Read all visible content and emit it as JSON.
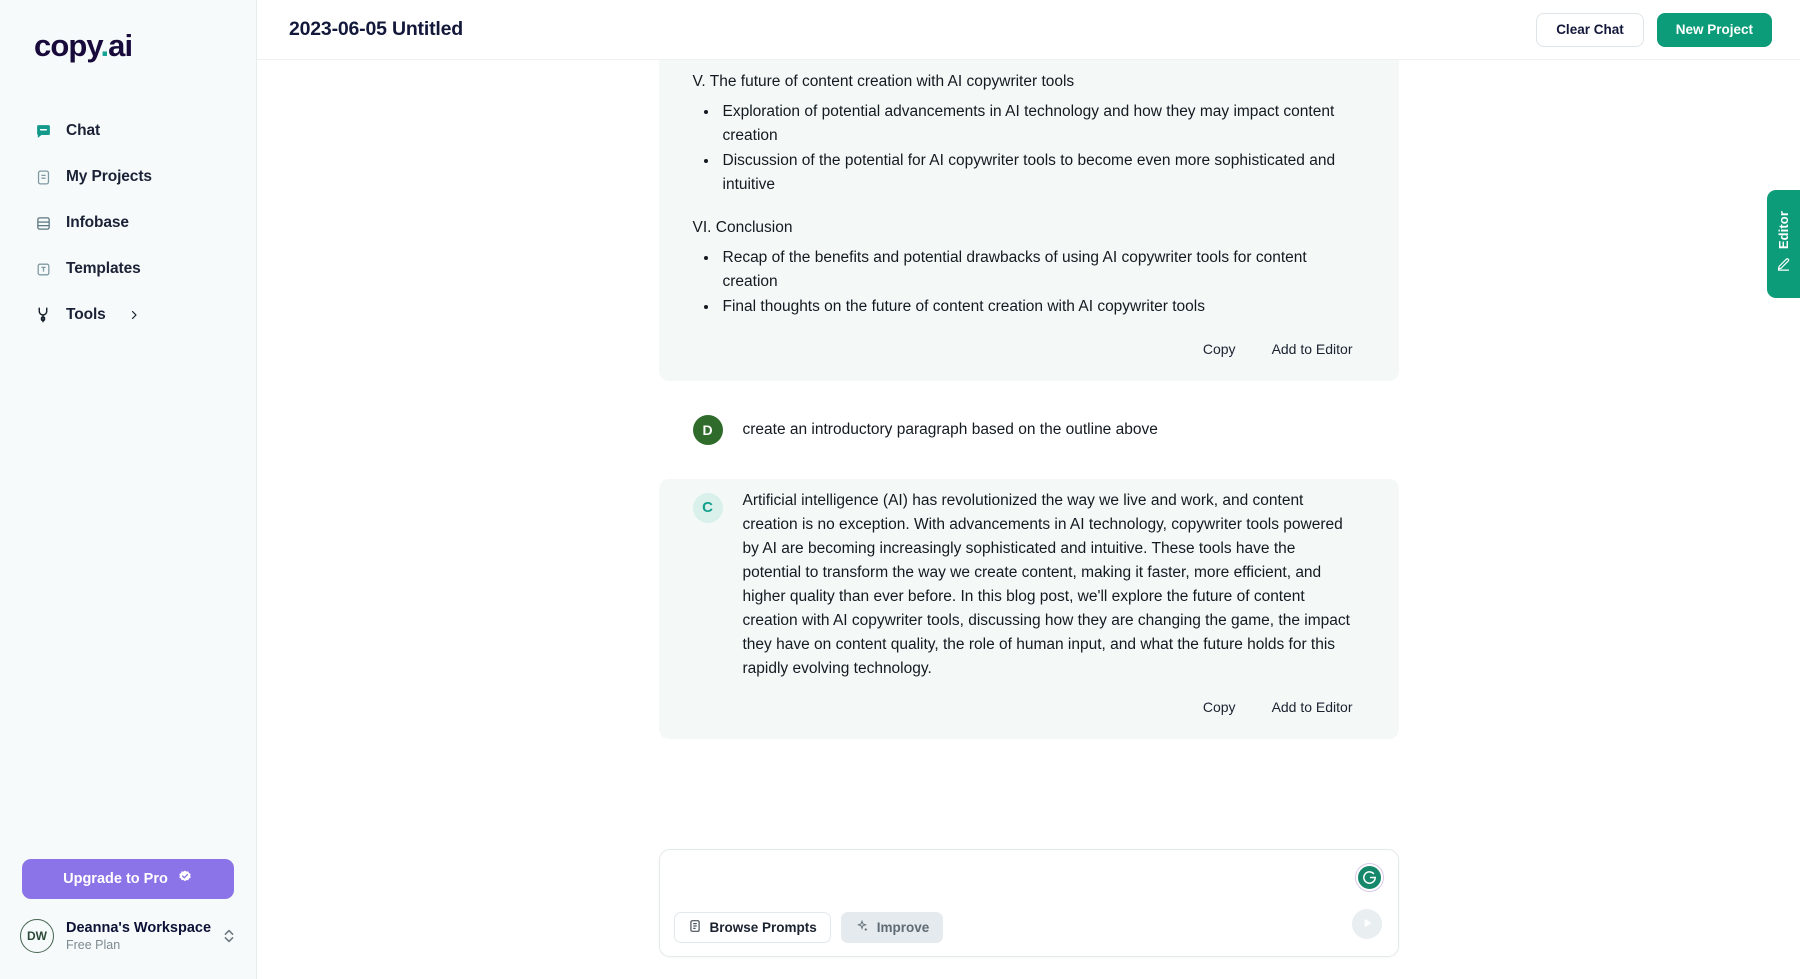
{
  "brand": {
    "name_part1": "copy",
    "dot": ".",
    "name_part2": "ai",
    "accent_color": "#16a394",
    "logo_color": "#190a3c"
  },
  "sidebar": {
    "items": [
      {
        "label": "Chat",
        "icon": "chat-bubble-icon",
        "active": true
      },
      {
        "label": "My Projects",
        "icon": "document-icon",
        "active": false
      },
      {
        "label": "Infobase",
        "icon": "database-icon",
        "active": false
      },
      {
        "label": "Templates",
        "icon": "template-icon",
        "active": false
      },
      {
        "label": "Tools",
        "icon": "tools-icon",
        "active": false,
        "chevron": true
      }
    ],
    "upgrade": {
      "label": "Upgrade to Pro",
      "icon": "verified-badge-icon",
      "color": "#8b73e8"
    },
    "workspace": {
      "initials": "DW",
      "name": "Deanna's Workspace",
      "plan": "Free Plan",
      "toggle_icon": "chevron-up-down-icon"
    }
  },
  "topbar": {
    "title": "2023-06-05 Untitled",
    "clear_chat_label": "Clear Chat",
    "new_project_label": "New Project",
    "primary_color": "#0d9c79"
  },
  "editor_tab": {
    "label": "Editor",
    "icon": "pen-edit-icon",
    "color": "#0d9c79"
  },
  "chat": {
    "messages": [
      {
        "role": "assistant",
        "avatar": "C",
        "sections": [
          {
            "heading": "V. The future of content creation with AI copywriter tools",
            "bullets": [
              "Exploration of potential advancements in AI technology and how they may impact content creation",
              "Discussion of the potential for AI copywriter tools to become even more sophisticated and intuitive"
            ]
          },
          {
            "heading": "VI. Conclusion",
            "bullets": [
              "Recap of the benefits and potential drawbacks of using AI copywriter tools for content creation",
              "Final thoughts on the future of content creation with AI copywriter tools"
            ]
          }
        ],
        "actions": {
          "copy": "Copy",
          "add_to_editor": "Add to Editor"
        }
      },
      {
        "role": "user",
        "avatar": "D",
        "text": "create an introductory paragraph based on the outline above"
      },
      {
        "role": "assistant",
        "avatar": "C",
        "paragraph": "Artificial intelligence (AI) has revolutionized the way we live and work, and content creation is no exception. With advancements in AI technology, copywriter tools powered by AI are becoming increasingly sophisticated and intuitive. These tools have the potential to transform the way we create content, making it faster, more efficient, and higher quality than ever before. In this blog post, we'll explore the future of content creation with AI copywriter tools, discussing how they are changing the game, the impact they have on content quality, the role of human input, and what the future holds for this rapidly evolving technology.",
        "actions": {
          "copy": "Copy",
          "add_to_editor": "Add to Editor"
        }
      }
    ]
  },
  "composer": {
    "value": "",
    "placeholder": "",
    "browse_prompts_label": "Browse Prompts",
    "browse_prompts_icon": "list-document-icon",
    "improve_label": "Improve",
    "improve_icon": "sparkle-icon",
    "grammarly_icon": "grammarly-g-icon",
    "send_icon": "send-play-icon"
  }
}
